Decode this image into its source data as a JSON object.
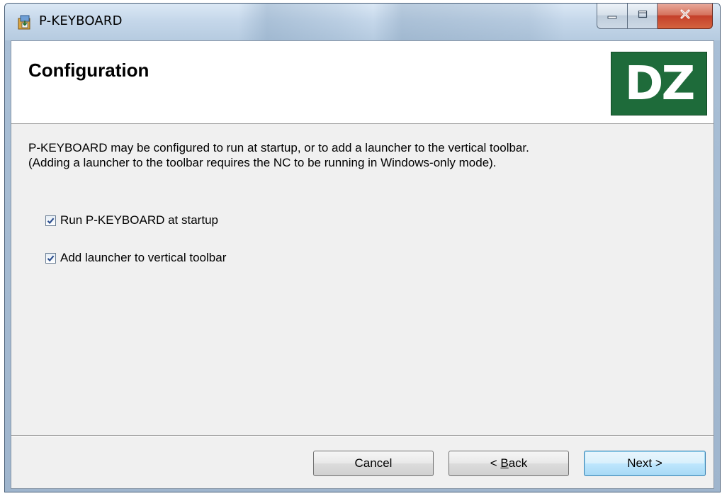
{
  "window": {
    "title": "P-KEYBOARD",
    "app_icon": "installer-icon",
    "caption_buttons": {
      "minimize_icon": "minimize-icon",
      "maximize_icon": "maximize-icon",
      "close_icon": "close-icon"
    }
  },
  "banner": {
    "title": "Configuration",
    "logo_text": "DZ",
    "logo_color": "#1e6b3a"
  },
  "body": {
    "description_line1": "P-KEYBOARD may be configured to run at startup, or to add a launcher to the vertical toolbar.",
    "description_line2": "(Adding a launcher to the toolbar requires the NC to be running in Windows-only mode)."
  },
  "options": [
    {
      "label": "Run P-KEYBOARD at startup",
      "checked": true
    },
    {
      "label": "Add launcher to vertical toolbar",
      "checked": true
    }
  ],
  "buttons": {
    "cancel_label": "Cancel",
    "back_prefix": "< ",
    "back_accel": "B",
    "back_rest": "ack",
    "next_label": "Next >"
  },
  "colors": {
    "accent_default_button": "#3c7fb1",
    "close_button": "#c4402a"
  }
}
